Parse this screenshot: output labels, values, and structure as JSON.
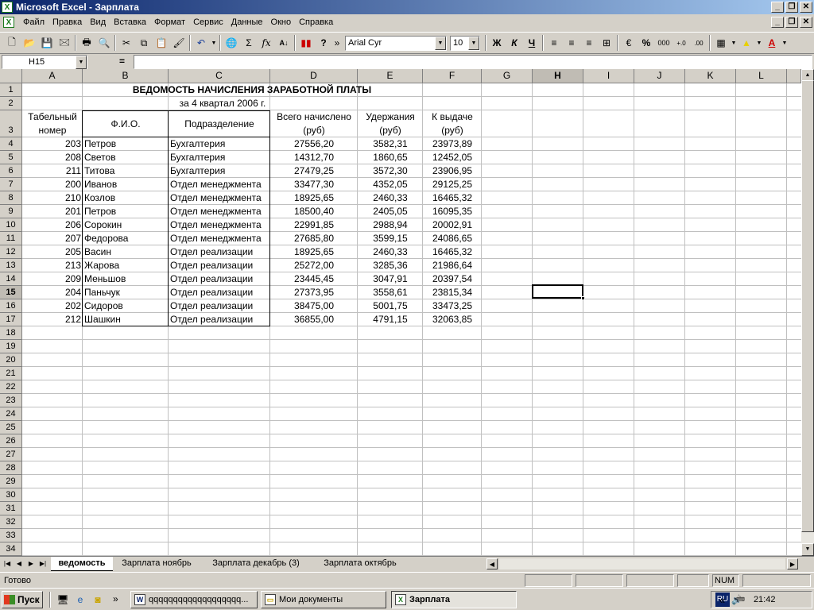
{
  "window": {
    "title": "Microsoft Excel - Зарплата"
  },
  "menu": [
    "Файл",
    "Правка",
    "Вид",
    "Вставка",
    "Формат",
    "Сервис",
    "Данные",
    "Окно",
    "Справка"
  ],
  "toolbar": {
    "font": "Arial Cyr",
    "size": "10",
    "bold": "Ж",
    "italic": "К",
    "underline": "Ч",
    "sigma": "Σ",
    "fx": "fx",
    "percent": "%",
    "thousands": "000",
    "more": "»"
  },
  "formula": {
    "namebox": "H15",
    "eq": "="
  },
  "columns": [
    "A",
    "B",
    "C",
    "D",
    "E",
    "F",
    "G",
    "H",
    "I",
    "J",
    "K",
    "L"
  ],
  "rows": [
    "1",
    "2",
    "3",
    "4",
    "5",
    "6",
    "7",
    "8",
    "9",
    "10",
    "11",
    "12",
    "13",
    "14",
    "15",
    "16",
    "17",
    "18",
    "19",
    "20",
    "21",
    "22",
    "23",
    "24",
    "25",
    "26",
    "27",
    "28",
    "29",
    "30",
    "31",
    "32",
    "33",
    "34"
  ],
  "sheet": {
    "title": "ВЕДОМОСТЬ НАЧИСЛЕНИЯ ЗАРАБОТНОЙ ПЛАТЫ",
    "subtitle": "за 4 квартал 2006 г.",
    "headers": {
      "a1": "Табельный",
      "a2": "номер",
      "b": "Ф.И.О.",
      "c": "Подразделение",
      "d1": "Всего начислено",
      "d2": "(руб)",
      "e1": "Удержания",
      "e2": "(руб)",
      "f1": "К выдаче",
      "f2": "(руб)"
    },
    "records": [
      [
        "203",
        "Петров",
        "Бухгалтерия",
        "27556,20",
        "3582,31",
        "23973,89"
      ],
      [
        "208",
        "Светов",
        "Бухгалтерия",
        "14312,70",
        "1860,65",
        "12452,05"
      ],
      [
        "211",
        "Титова",
        "Бухгалтерия",
        "27479,25",
        "3572,30",
        "23906,95"
      ],
      [
        "200",
        "Иванов",
        "Отдел менеджмента",
        "33477,30",
        "4352,05",
        "29125,25"
      ],
      [
        "210",
        "Козлов",
        "Отдел менеджмента",
        "18925,65",
        "2460,33",
        "16465,32"
      ],
      [
        "201",
        "Петров",
        "Отдел менеджмента",
        "18500,40",
        "2405,05",
        "16095,35"
      ],
      [
        "206",
        "Сорокин",
        "Отдел менеджмента",
        "22991,85",
        "2988,94",
        "20002,91"
      ],
      [
        "207",
        "Федорова",
        "Отдел менеджмента",
        "27685,80",
        "3599,15",
        "24086,65"
      ],
      [
        "205",
        "Васин",
        "Отдел реализации",
        "18925,65",
        "2460,33",
        "16465,32"
      ],
      [
        "213",
        "Жарова",
        "Отдел реализации",
        "25272,00",
        "3285,36",
        "21986,64"
      ],
      [
        "209",
        "Меньшов",
        "Отдел реализации",
        "23445,45",
        "3047,91",
        "20397,54"
      ],
      [
        "204",
        "Паньчук",
        "Отдел реализации",
        "27373,95",
        "3558,61",
        "23815,34"
      ],
      [
        "202",
        "Сидоров",
        "Отдел реализации",
        "38475,00",
        "5001,75",
        "33473,25"
      ],
      [
        "212",
        "Шашкин",
        "Отдел реализации",
        "36855,00",
        "4791,15",
        "32063,85"
      ]
    ]
  },
  "tabs": [
    "ведомость",
    "Зарплата ноябрь",
    "Зарплата декабрь (3)",
    "Зарплата октябрь"
  ],
  "status": {
    "ready": "Готово",
    "num": "NUM"
  },
  "taskbar": {
    "start": "Пуск",
    "more": "»",
    "items": [
      "qqqqqqqqqqqqqqqqqqq...",
      "Мои документы",
      "Зарплата"
    ],
    "lang": "RU",
    "tray_more": "«",
    "clock": "21:42"
  }
}
